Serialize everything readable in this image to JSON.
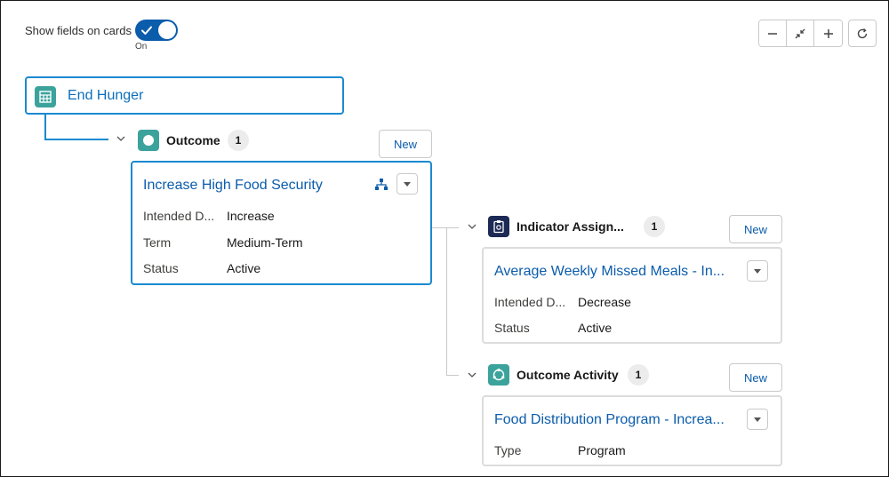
{
  "toggle": {
    "label": "Show fields on cards",
    "state": "On"
  },
  "zoom": {
    "zoom_out": "zoom-out",
    "fit": "fit",
    "zoom_in": "zoom-in",
    "refresh": "refresh"
  },
  "root": {
    "title": "End Hunger",
    "icon": "goal-icon"
  },
  "outcome_section": {
    "title": "Outcome",
    "count": "1",
    "new_label": "New",
    "card": {
      "title": "Increase High Food Security",
      "fields": [
        {
          "label": "Intended D...",
          "value": "Increase"
        },
        {
          "label": "Term",
          "value": "Medium-Term"
        },
        {
          "label": "Status",
          "value": "Active"
        }
      ]
    }
  },
  "indicator_section": {
    "title": "Indicator Assign...",
    "count": "1",
    "new_label": "New",
    "card": {
      "title": "Average Weekly Missed Meals - In...",
      "fields": [
        {
          "label": "Intended D...",
          "value": "Decrease"
        },
        {
          "label": "Status",
          "value": "Active"
        }
      ]
    }
  },
  "activity_section": {
    "title": "Outcome Activity",
    "count": "1",
    "new_label": "New",
    "card": {
      "title": "Food Distribution Program - Increa...",
      "fields": [
        {
          "label": "Type",
          "value": "Program"
        }
      ]
    }
  },
  "colors": {
    "accent": "#0b5cab",
    "selected_border": "#1b8ad0",
    "teal": "#3ba39c",
    "navy": "#1c2a55"
  }
}
